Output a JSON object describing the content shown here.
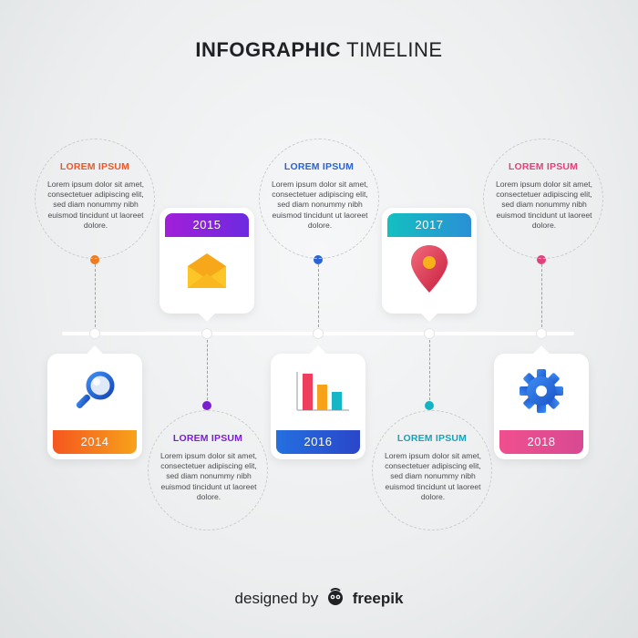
{
  "title": {
    "bold": "INFOGRAPHIC",
    "light": "TIMELINE"
  },
  "bubbles": [
    {
      "heading": "LOREM IPSUM",
      "text": "Lorem ipsum dolor sit amet, consectetuer adipiscing elit, sed diam nonummy nibh euismod tincidunt ut laoreet dolore.",
      "color": "#e8582a"
    },
    {
      "heading": "LOREM IPSUM",
      "text": "Lorem ipsum dolor sit amet, consectetuer adipiscing elit, sed diam nonummy nibh euismod tincidunt ut laoreet dolore.",
      "color": "#7a1fd0"
    },
    {
      "heading": "LOREM IPSUM",
      "text": "Lorem ipsum dolor sit amet, consectetuer adipiscing elit, sed diam nonummy nibh euismod tincidunt ut laoreet dolore.",
      "color": "#2a63d6"
    },
    {
      "heading": "LOREM IPSUM",
      "text": "Lorem ipsum dolor sit amet, consectetuer adipiscing elit, sed diam nonummy nibh euismod tincidunt ut laoreet dolore.",
      "color": "#1aa2b6"
    },
    {
      "heading": "LOREM IPSUM",
      "text": "Lorem ipsum dolor sit amet, consectetuer adipiscing elit, sed diam nonummy nibh euismod tincidunt ut laoreet dolore.",
      "color": "#e0427c"
    }
  ],
  "cards": [
    {
      "year": "2014",
      "icon": "magnifier-icon",
      "color": "#f07a1e"
    },
    {
      "year": "2015",
      "icon": "envelope-icon",
      "color": "#8a22d8"
    },
    {
      "year": "2016",
      "icon": "bar-chart-icon",
      "color": "#2a63d6"
    },
    {
      "year": "2017",
      "icon": "location-pin-icon",
      "color": "#14b3c2"
    },
    {
      "year": "2018",
      "icon": "gear-icon",
      "color": "#e0427c"
    }
  ],
  "footer": {
    "prefix": "designed by",
    "brand": "freepik",
    "logo": "freepik-logo-icon"
  }
}
